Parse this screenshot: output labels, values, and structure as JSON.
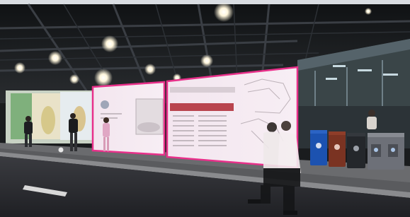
{
  "scene": {
    "setting": "covered-walkway-at-night",
    "highlighted_billboards": 2,
    "highlight_color": "#e8308a"
  },
  "billboard_right": {
    "header_title": "",
    "header_subtitle": ""
  },
  "colors": {
    "ceiling": "#15171a",
    "road": "#2b2c30",
    "sidewalk": "#6a6b6e",
    "bin_blue": "#1c52b0",
    "bin_brown": "#7a3322",
    "bin_black": "#24272b",
    "bin_gray": "#6d7078"
  }
}
